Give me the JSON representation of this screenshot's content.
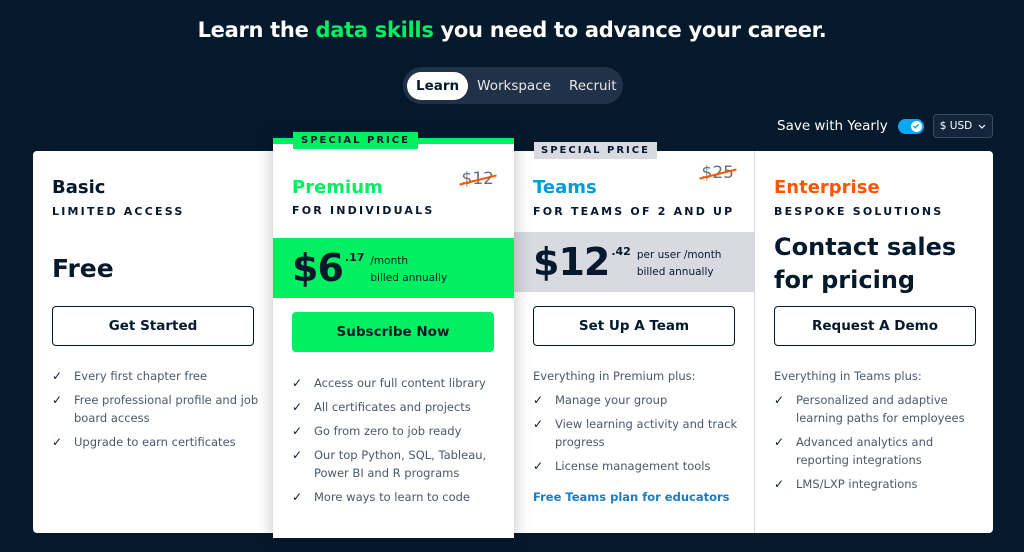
{
  "headline": {
    "before": "Learn the ",
    "accent": "data skills",
    "after": " you need to advance your career."
  },
  "tabs": [
    {
      "label": "Learn",
      "active": true
    },
    {
      "label": "Workspace",
      "active": false
    },
    {
      "label": "Recruit",
      "active": false
    }
  ],
  "billing": {
    "yearly_label": "Save with Yearly",
    "yearly_enabled": true,
    "currency": "$ USD"
  },
  "colors": {
    "background": "#05192d",
    "green": "#03ef62",
    "blue": "#009bd8",
    "orange": "#ff5400",
    "gray_band": "#d9d9e2"
  },
  "plans": {
    "basic": {
      "name": "Basic",
      "subtitle": "LIMITED ACCESS",
      "price": "Free",
      "button": "Get Started",
      "features": [
        "Every first chapter free",
        "Free professional profile and job board access",
        "Upgrade to earn certificates"
      ]
    },
    "premium": {
      "badge": "SPECIAL PRICE",
      "name": "Premium",
      "subtitle": "FOR INDIVIDUALS",
      "old_price": "$12",
      "price_whole": "$6",
      "price_cents": ".17",
      "price_period": "/month",
      "price_billing": "billed annually",
      "button": "Subscribe Now",
      "features": [
        "Access our full content library",
        "All certificates and projects",
        "Go from zero to job ready",
        "Our top Python, SQL, Tableau, Power BI and R programs",
        "More ways to learn to code"
      ]
    },
    "teams": {
      "badge": "SPECIAL PRICE",
      "name": "Teams",
      "subtitle": "FOR TEAMS OF 2 AND UP",
      "old_price": "$25",
      "price_whole": "$12",
      "price_cents": ".42",
      "price_period": "per user /month",
      "price_billing": "billed annually",
      "button": "Set Up A Team",
      "intro": "Everything in Premium plus:",
      "features": [
        "Manage your group",
        "View learning activity and track progress",
        "License management tools"
      ],
      "link": "Free Teams plan for educators"
    },
    "enterprise": {
      "name": "Enterprise",
      "subtitle": "BESPOKE SOLUTIONS",
      "price": "Contact sales for pricing",
      "button": "Request A Demo",
      "intro": "Everything in Teams plus:",
      "features": [
        "Personalized and adaptive learning paths for employees",
        "Advanced analytics and reporting integrations",
        "LMS/LXP integrations"
      ]
    }
  }
}
